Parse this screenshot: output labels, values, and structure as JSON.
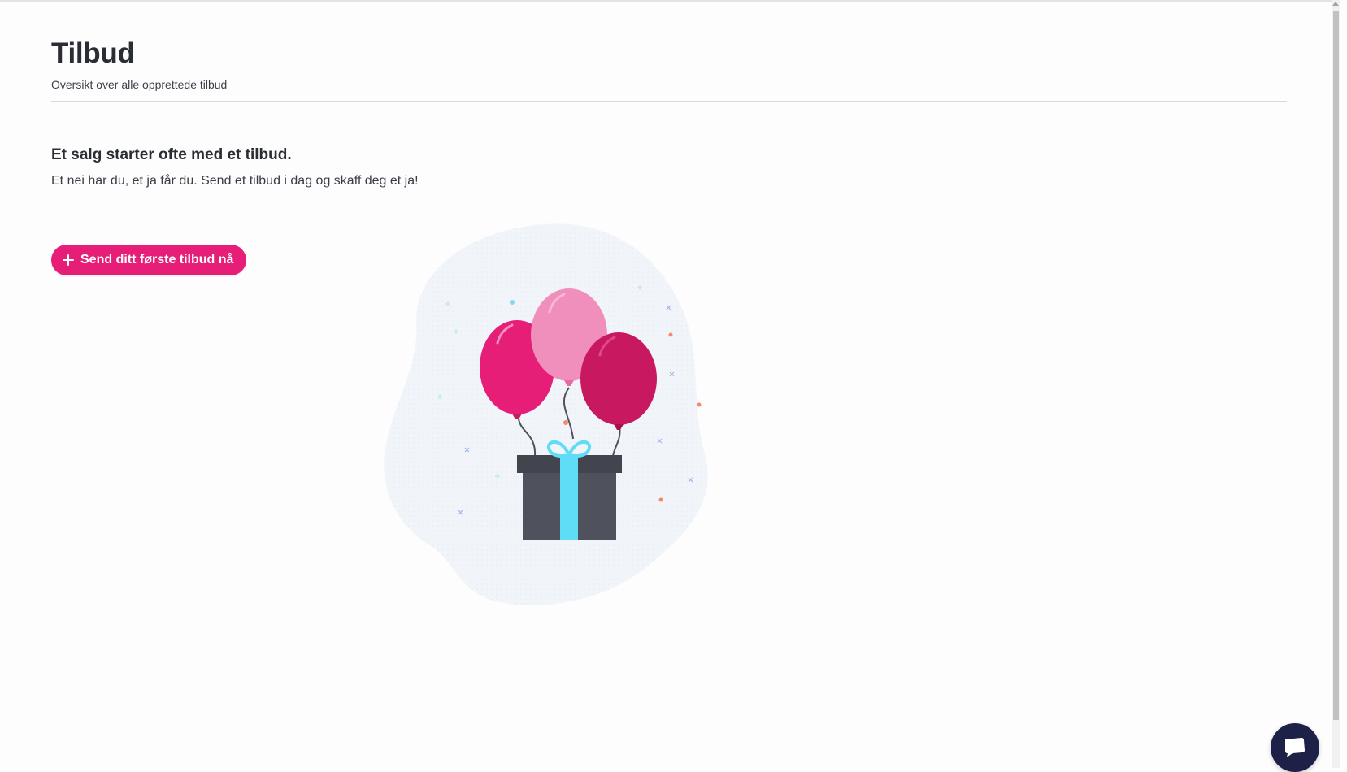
{
  "header": {
    "title": "Tilbud",
    "subtitle": "Oversikt over alle opprettede tilbud"
  },
  "empty_state": {
    "heading": "Et salg starter ofte med et tilbud.",
    "text": "Et nei har du, et ja får du. Send et tilbud i dag og skaff deg et ja!",
    "button_label": "Send ditt første tilbud nå",
    "illustration": "balloons-gift-illustration"
  },
  "icons": {
    "button_icon": "plus-icon",
    "chat_icon": "chat-bubble-icon"
  },
  "colors": {
    "accent": "#e61e78",
    "balloon_light": "#f08fbc",
    "balloon_dark": "#c8185f",
    "gift_box": "#4f525c",
    "ribbon": "#5fdcf6",
    "chat_button": "#1e2147"
  }
}
